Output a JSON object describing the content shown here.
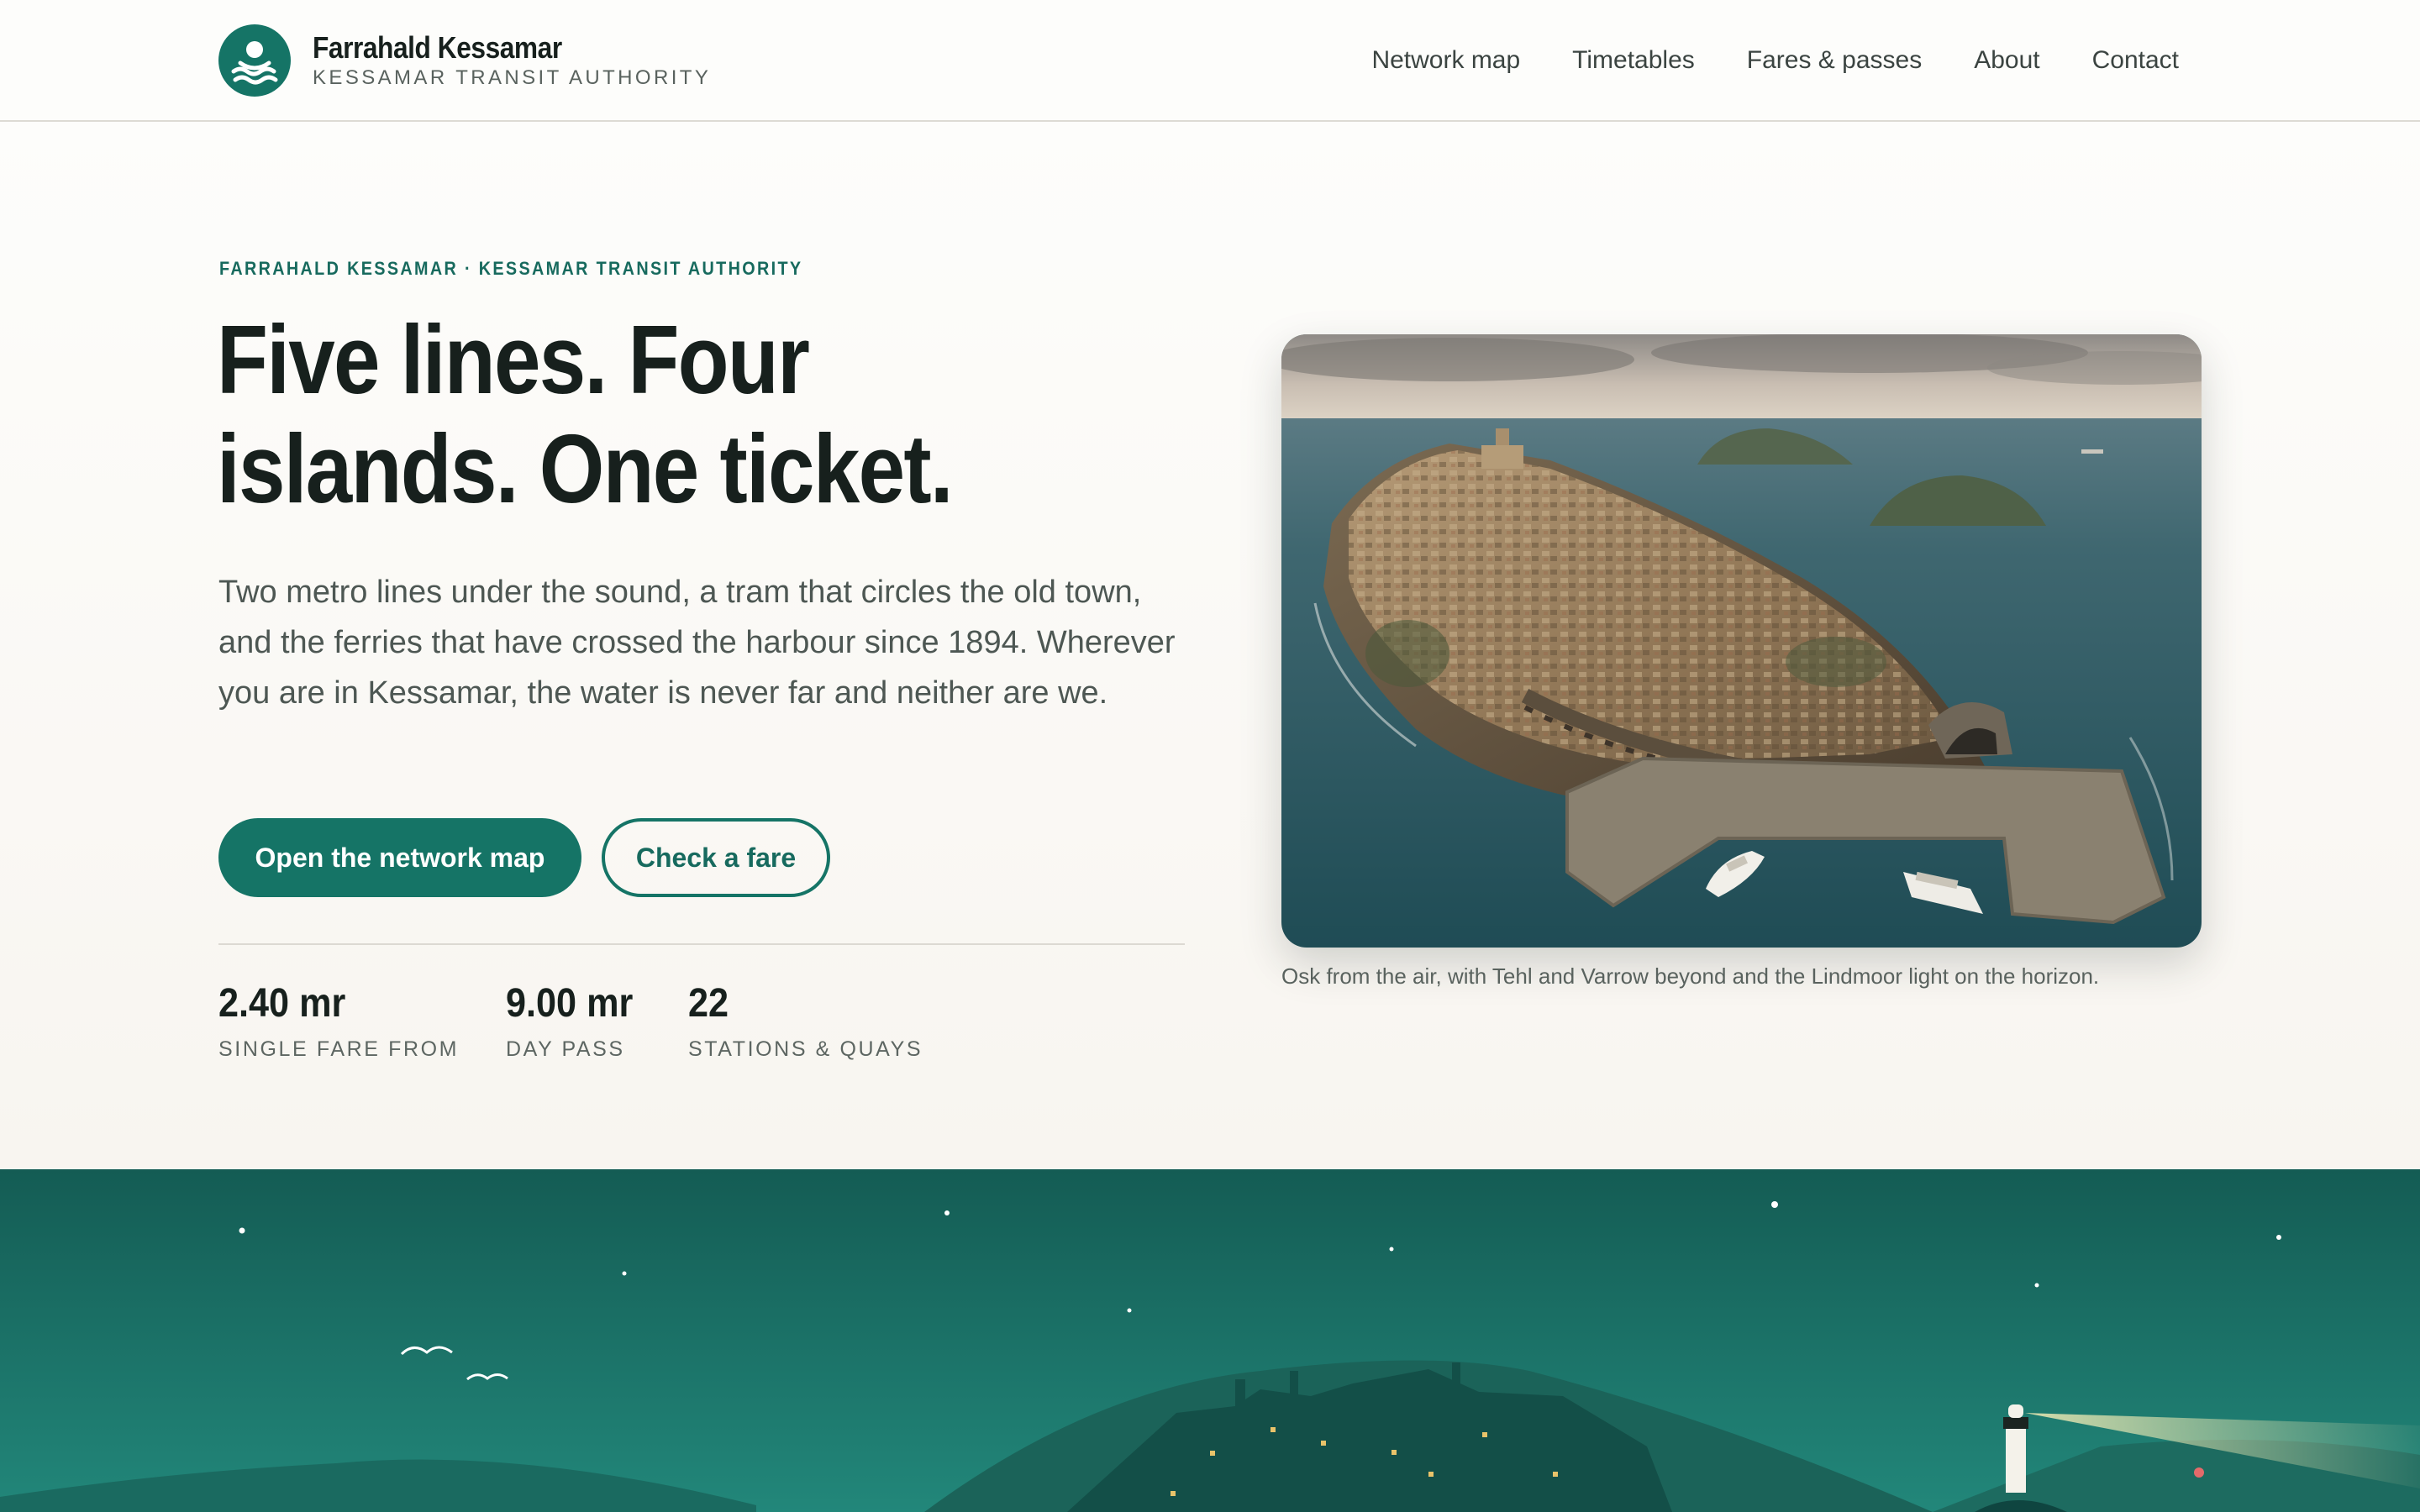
{
  "header": {
    "brand_name": "Farrahald Kessamar",
    "brand_sub": "KESSAMAR TRANSIT AUTHORITY",
    "logo_icon": "swimmer-waves-icon",
    "nav": [
      {
        "label": "Network map"
      },
      {
        "label": "Timetables"
      },
      {
        "label": "Fares & passes"
      },
      {
        "label": "About"
      },
      {
        "label": "Contact"
      }
    ]
  },
  "hero": {
    "eyebrow": "FARRAHALD KESSAMAR · KESSAMAR TRANSIT AUTHORITY",
    "headline_line1": "Five lines. Four",
    "headline_line2": "islands. One ticket.",
    "lede": "Two metro lines under the sound, a tram that circles the old town, and the ferries that have crossed the harbour since 1894. Wherever you are in Kessamar, the water is never far and neither are we.",
    "primary_cta": "Open the network map",
    "secondary_cta": "Check a fare",
    "stats": [
      {
        "value": "2.40 mr",
        "label": "SINGLE FARE FROM"
      },
      {
        "value": "9.00 mr",
        "label": "DAY PASS"
      },
      {
        "value": "22",
        "label": "STATIONS & QUAYS"
      }
    ],
    "photo_caption": "Osk from the air, with Tehl and Varrow beyond and the Lindmoor light on the horizon."
  },
  "colors": {
    "brand": "#157466",
    "ink": "#17201d",
    "night_top": "#145c54",
    "night_bottom": "#22877a"
  }
}
